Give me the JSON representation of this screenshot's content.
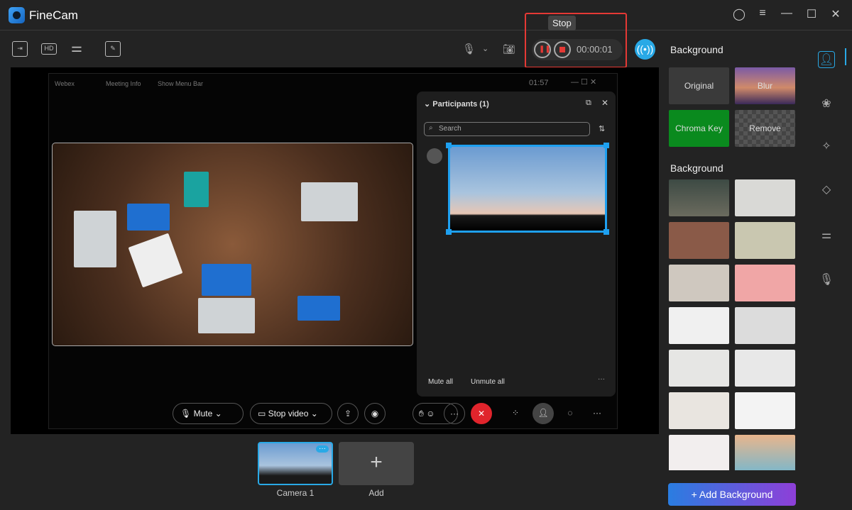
{
  "app": {
    "title": "FineCam"
  },
  "recording": {
    "tooltip": "Stop",
    "timer": "00:00:01"
  },
  "webex": {
    "brand": "Webex",
    "meeting_info": "Meeting Info",
    "show_menu": "Show Menu Bar",
    "clock": "01:57",
    "participants": {
      "title": "Participants (1)",
      "search_placeholder": "Search",
      "mute_all": "Mute all",
      "unmute_all": "Unmute all"
    },
    "controls": {
      "mute": "Mute",
      "stop_video": "Stop video"
    }
  },
  "right_panel": {
    "section1": "Background",
    "presets": [
      "Original",
      "Blur",
      "Chroma Key",
      "Remove"
    ],
    "section2": "Background",
    "add_button": "+ Add Background"
  },
  "cameras": [
    {
      "label": "Camera 1"
    },
    {
      "label": "Add"
    }
  ],
  "colors": {
    "accent": "#29a9e6",
    "record_highlight": "#e53935",
    "chroma": "#0a8a1e"
  }
}
